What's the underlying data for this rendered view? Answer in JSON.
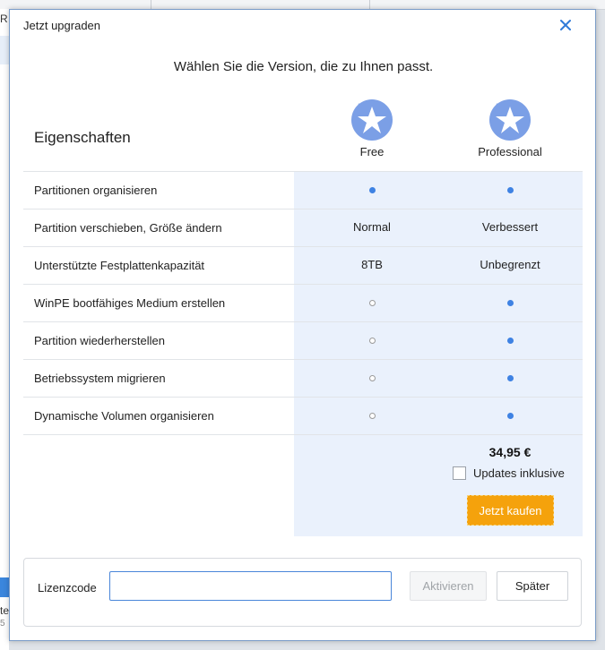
{
  "dialog": {
    "title": "Jetzt upgraden",
    "subtitle": "Wählen Sie die Version, die zu Ihnen passt."
  },
  "background": {
    "fragments": [
      "R",
      "te",
      "5"
    ]
  },
  "table": {
    "header_label": "Eigenschaften",
    "versions": [
      {
        "name": "Free",
        "icon": "star-badge-icon"
      },
      {
        "name": "Professional",
        "icon": "star-badge-icon"
      }
    ],
    "rows": [
      {
        "feature": "Partitionen organisieren",
        "free": {
          "type": "dot"
        },
        "pro": {
          "type": "dot"
        }
      },
      {
        "feature": "Partition verschieben, Größe ändern",
        "free": {
          "type": "text",
          "value": "Normal"
        },
        "pro": {
          "type": "text",
          "value": "Verbessert"
        }
      },
      {
        "feature": "Unterstützte Festplattenkapazität",
        "free": {
          "type": "text",
          "value": "8TB"
        },
        "pro": {
          "type": "text",
          "value": "Unbegrenzt"
        }
      },
      {
        "feature": "WinPE bootfähiges Medium erstellen",
        "free": {
          "type": "ring"
        },
        "pro": {
          "type": "dot"
        }
      },
      {
        "feature": "Partition wiederherstellen",
        "free": {
          "type": "ring"
        },
        "pro": {
          "type": "dot"
        }
      },
      {
        "feature": "Betriebssystem migrieren",
        "free": {
          "type": "ring"
        },
        "pro": {
          "type": "dot"
        }
      },
      {
        "feature": "Dynamische Volumen organisieren",
        "free": {
          "type": "ring"
        },
        "pro": {
          "type": "dot"
        }
      }
    ]
  },
  "purchase": {
    "price": "34,95 €",
    "updates_label": "Updates inklusive",
    "updates_checked": false,
    "buy_label": "Jetzt kaufen"
  },
  "license": {
    "label": "Lizenzcode",
    "value": "",
    "activate_label": "Aktivieren",
    "later_label": "Später"
  },
  "colors": {
    "accent": "#3e82e3",
    "buy": "#f5a20c",
    "shade": "#eaf1fc",
    "icon": "#7b9fe6"
  }
}
